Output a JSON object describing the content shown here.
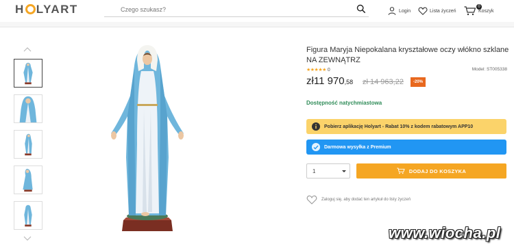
{
  "header": {
    "logo": "H LYART",
    "search_placeholder": "Czego szukasz?",
    "login_label": "Login",
    "wishlist_label": "Lista życzeń",
    "cart_label": "Koszyk",
    "cart_count": "0"
  },
  "product": {
    "title": "Figura Maryja Niepokalana kryształowe oczy włókno szklane NA ZEWNĄTRZ",
    "rating_stars": "★★★★★",
    "rating_count": "0",
    "model": "Model: ST005338",
    "price_currency": "zł",
    "price_main": "11 970",
    "price_cents": ",58",
    "old_price": "zł 14 963,22",
    "discount": "-20%",
    "availability": "Dostępność natychmiastowa",
    "app_banner": "Pobierz aplikację Holyart - Rabat 10% z kodem rabatowym APP10",
    "shipping_banner": "Darmowa wysyłka z Premium",
    "quantity": "1",
    "add_to_cart": "DODAJ DO KOSZYKA",
    "wishlist_note": "Zaloguj się, aby dodać ten artykuł do listy życzeń"
  },
  "watermark": "www.wiocha.pl",
  "colors": {
    "accent": "#f5a623",
    "discount": "#e8681e",
    "available": "#2e8b57",
    "premium": "#2196f3",
    "app_banner": "#fbd36a"
  },
  "icons": [
    "search-icon",
    "user-icon",
    "heart-icon",
    "cart-icon",
    "info-icon",
    "premium-icon",
    "chevron-up-icon",
    "chevron-down-icon"
  ]
}
